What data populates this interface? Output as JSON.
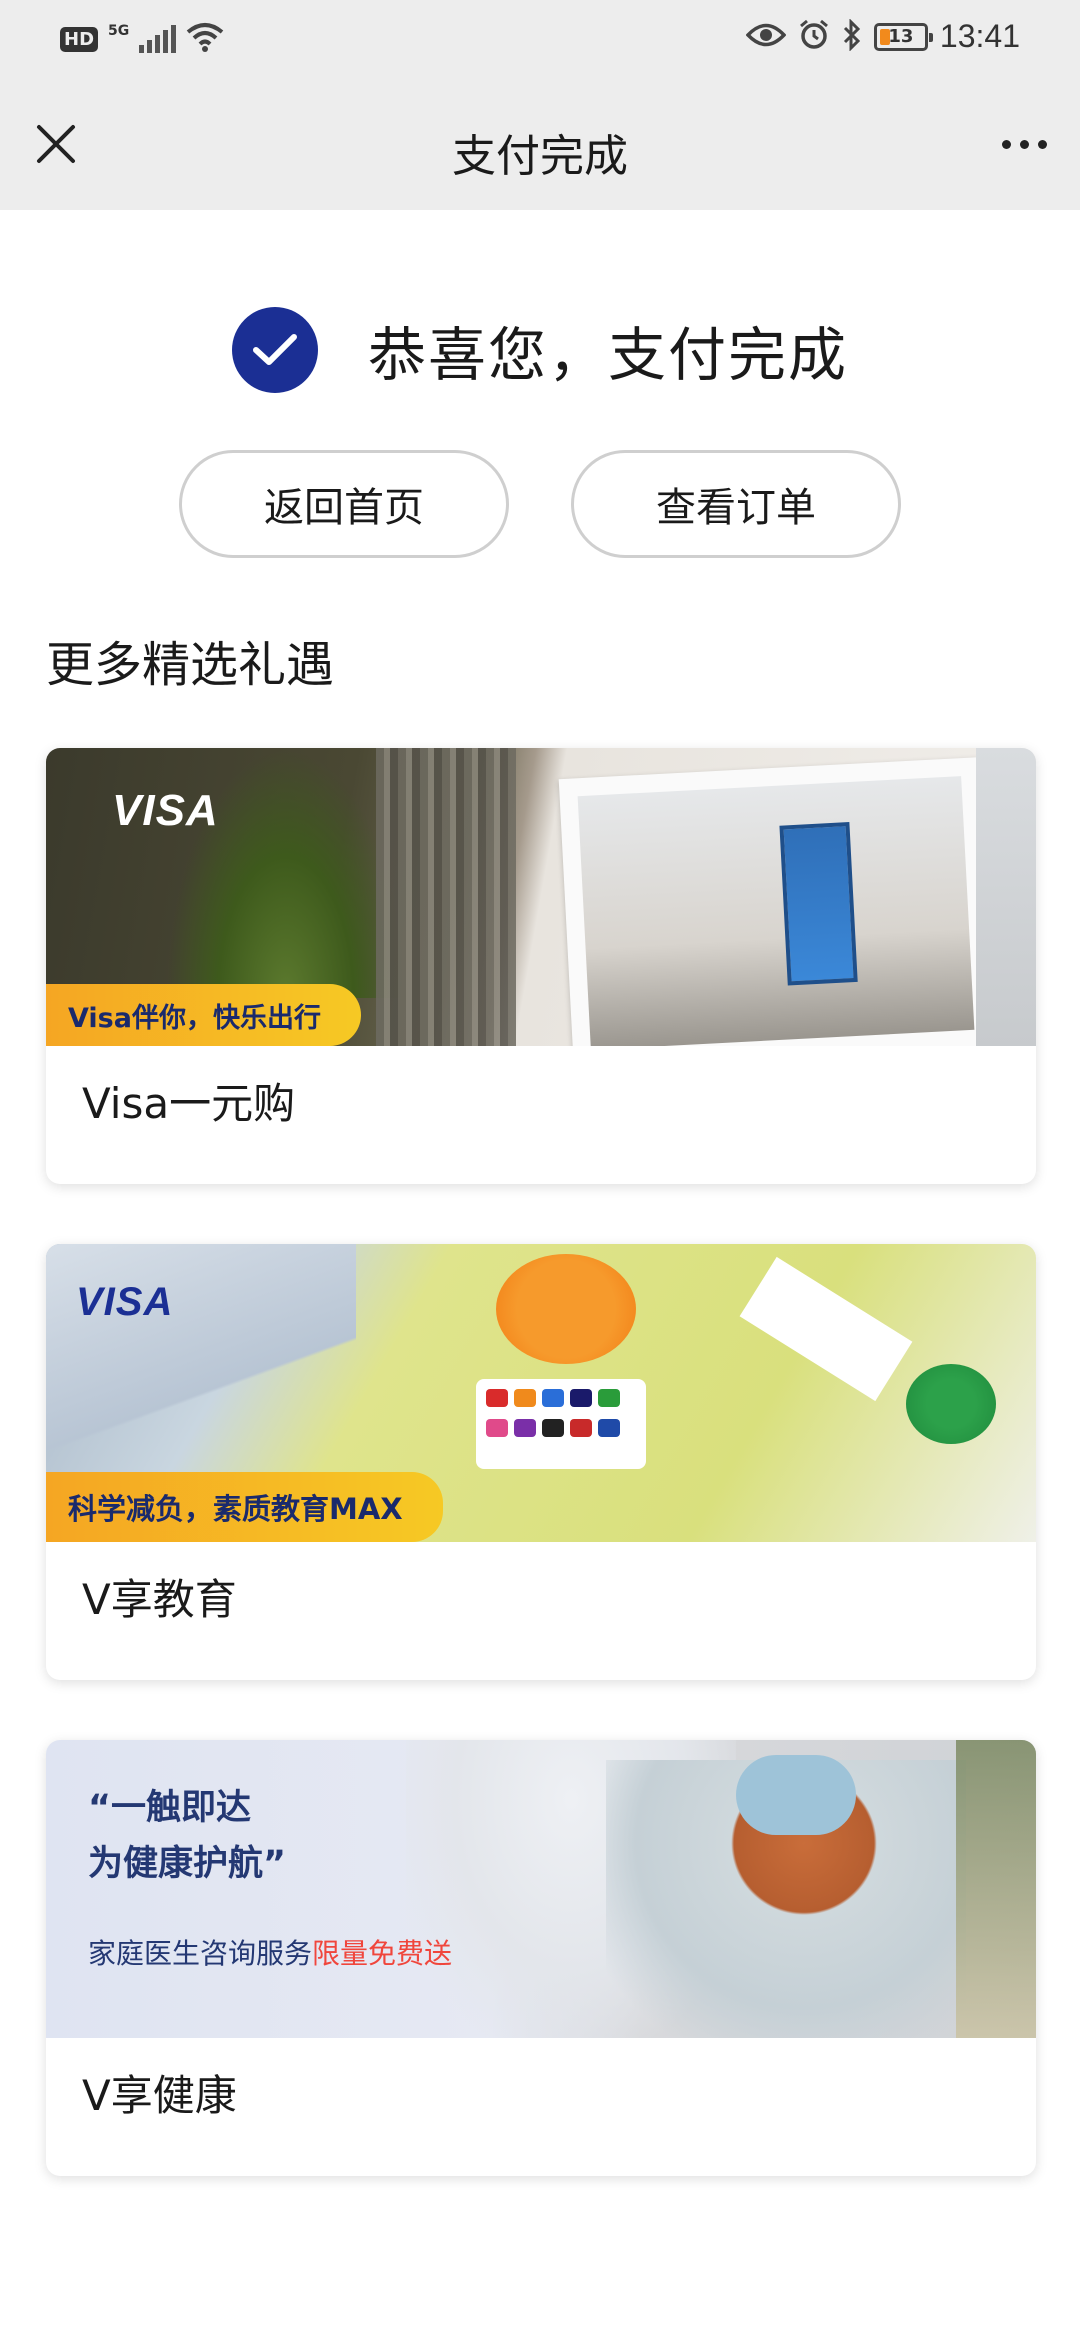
{
  "status_bar": {
    "hd": "HD",
    "network": "5G",
    "battery": "13",
    "time": "13:41"
  },
  "nav": {
    "title": "支付完成"
  },
  "success": {
    "message": "恭喜您，支付完成",
    "accent_color": "#1b2f94"
  },
  "buttons": {
    "home": "返回首页",
    "orders": "查看订单"
  },
  "section": {
    "title": "更多精选礼遇"
  },
  "cards": [
    {
      "brand": "VISA",
      "tag": "Visa伴你，快乐出行",
      "label": "Visa一元购"
    },
    {
      "brand": "VISA",
      "tag": "科学减负，素质教育MAX",
      "label": "V享教育"
    },
    {
      "quote_line1": "“一触即达",
      "quote_line2": "为健康护航”",
      "sub_text": "家庭医生咨询服务",
      "sub_highlight": "限量免费送",
      "label": "V享健康"
    }
  ]
}
